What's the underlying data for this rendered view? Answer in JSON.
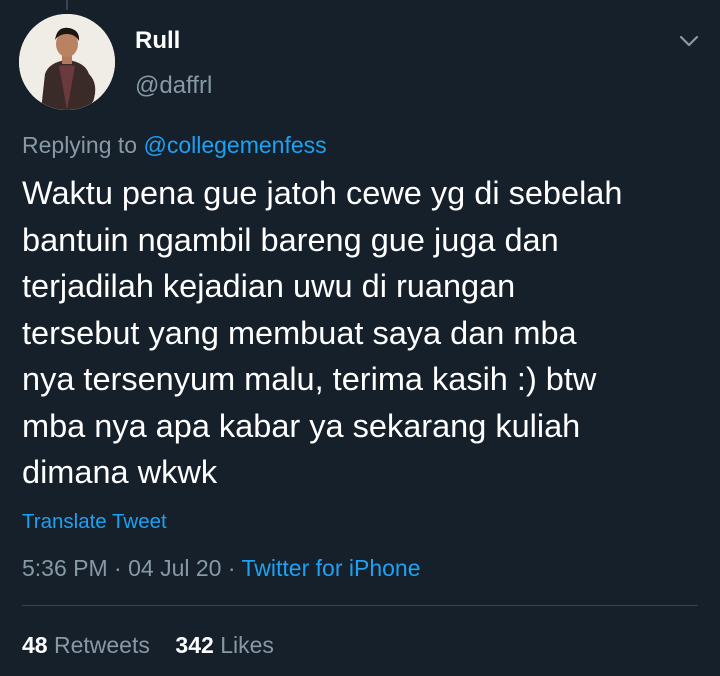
{
  "author": {
    "display_name": "Rull",
    "handle": "@daffrl"
  },
  "reply": {
    "prefix": "Replying to",
    "mention": "@collegemenfess"
  },
  "tweet": {
    "lines": [
      "Waktu pena gue jatoh cewe yg di sebelah",
      "bantuin ngambil bareng gue juga dan",
      "terjadilah kejadian uwu di ruangan",
      "tersebut yang membuat saya dan mba",
      "nya tersenyum malu, terima kasih :) btw",
      "mba nya apa kabar ya sekarang kuliah",
      "dimana wkwk"
    ]
  },
  "translate_label": "Translate Tweet",
  "meta": {
    "time": "5:36 PM",
    "separator": "·",
    "date": "04 Jul 20",
    "source": "Twitter for iPhone"
  },
  "stats": {
    "retweets_count": "48",
    "retweets_label": "Retweets",
    "likes_count": "342",
    "likes_label": "Likes"
  },
  "colors": {
    "background": "#15202b",
    "accent": "#1da1f2",
    "secondary_text": "#8899a6",
    "divider": "#38444d"
  },
  "icons": {
    "more": "chevron-down-icon"
  }
}
